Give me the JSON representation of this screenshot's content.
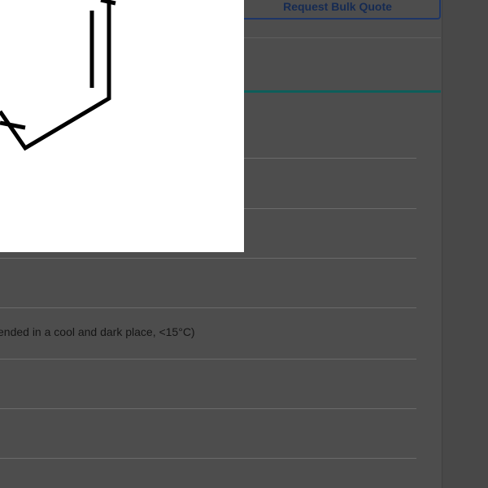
{
  "actions": {
    "bulk_quote_label": "Request Bulk Quote"
  },
  "specs": {
    "storage_value": "ended in a cool and dark place, <15°C)"
  },
  "structure": {
    "image": "chemical-structure-drawing"
  }
}
